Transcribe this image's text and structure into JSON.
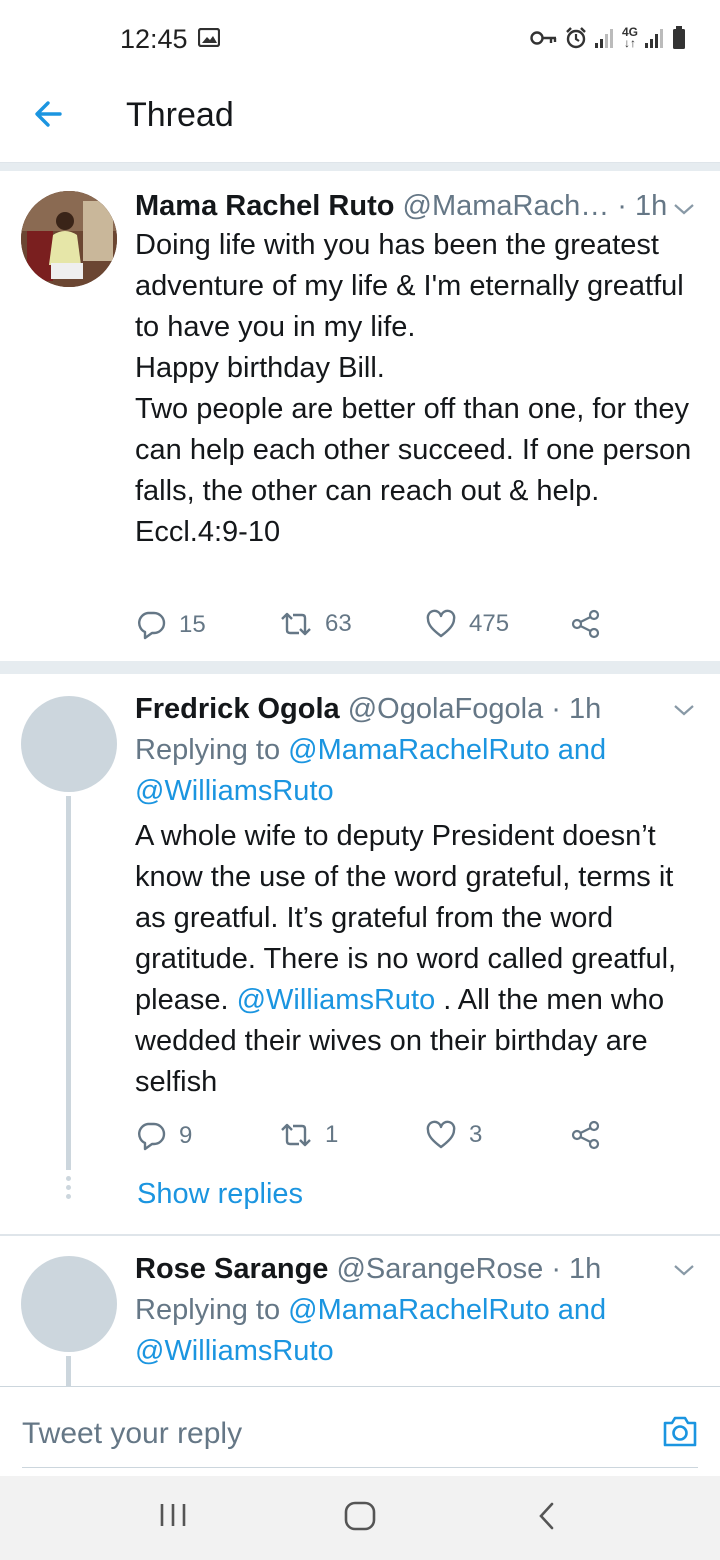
{
  "status_bar": {
    "time": "12:45",
    "network_top": "4G",
    "network_bottom": "↓↑"
  },
  "header": {
    "title": "Thread"
  },
  "tweets": [
    {
      "name": "Mama Rachel Ruto",
      "handle": "@MamaRach…",
      "time": "· 1h",
      "paragraphs": [
        "Doing life with you has been the greatest adventure of my life & I'm eternally greatful to have you in my life.",
        "Happy birthday Bill.",
        "Two people are better off than one, for they can help each other succeed. If one person falls, the other can reach out & help.",
        "Eccl.4:9-10"
      ],
      "replies": "15",
      "retweets": "63",
      "likes": "475"
    },
    {
      "name": "Fredrick Ogola",
      "handle": "@OgolaFogola",
      "time": "· 1h",
      "replying_prefix": "Replying to ",
      "replying_to_1": "@MamaRachelRuto and",
      "replying_to_2": "@WilliamsRuto",
      "text_part1": "A whole wife to deputy President doesn’t know the use of the word grateful, terms it as greatful. It’s grateful from the word gratitude. There is no word called greatful, please. ",
      "mention": "@WilliamsRuto",
      "text_part2": " . All the men who wedded their wives on their birthday are selfish",
      "replies": "9",
      "retweets": "1",
      "likes": "3",
      "show_replies": "Show replies"
    },
    {
      "name": "Rose Sarange",
      "handle": "@SarangeRose",
      "time": "· 1h",
      "replying_prefix": "Replying to ",
      "replying_to_1": "@MamaRachelRuto and",
      "replying_to_2": "@WilliamsRuto"
    }
  ],
  "reply_bar": {
    "placeholder": "Tweet your reply"
  },
  "colors": {
    "link": "#1b95e0",
    "secondary_text": "#657786",
    "divider": "#e6ecf0"
  },
  "icons": [
    "image-icon",
    "key-icon",
    "alarm-icon",
    "signal-icon",
    "battery-icon",
    "back-arrow-icon",
    "chevron-down-icon",
    "reply-icon",
    "retweet-icon",
    "like-icon",
    "share-icon",
    "camera-icon",
    "recents-icon",
    "home-icon",
    "nav-back-icon"
  ]
}
